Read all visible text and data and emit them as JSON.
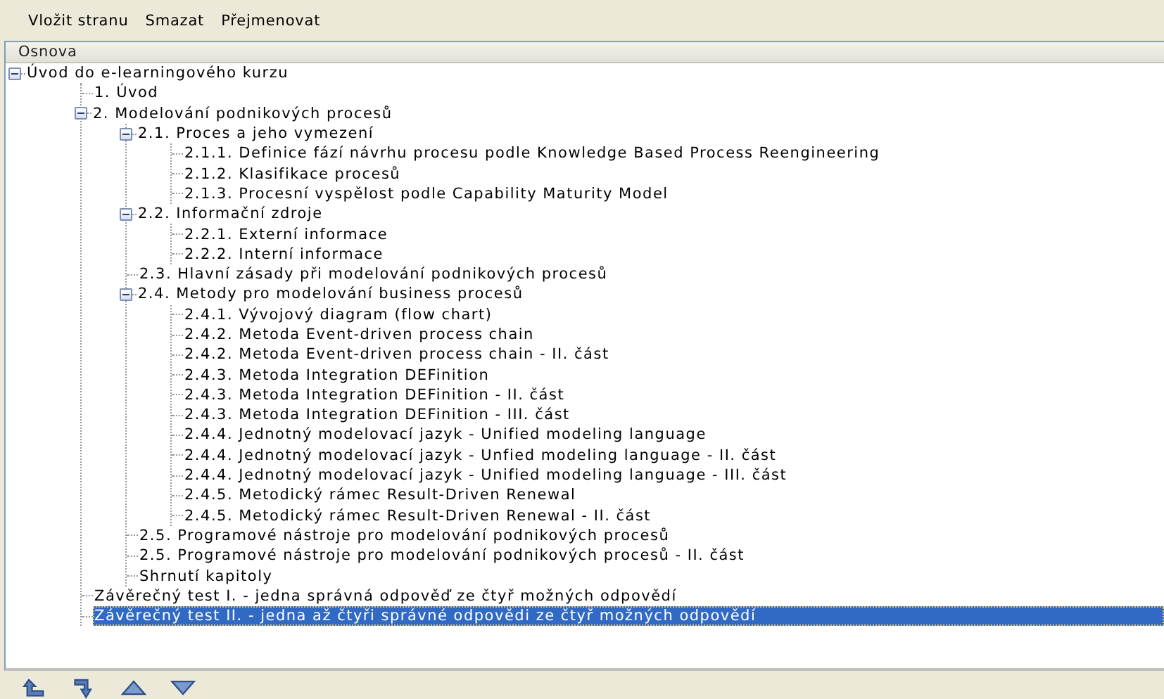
{
  "menu": [
    "Vložit stranu",
    "Smazat",
    "Přejmenovat"
  ],
  "outline": {
    "header": "Osnova",
    "items": [
      {
        "label": "Úvod do e-learningového kurzu",
        "expanded": true,
        "selected": false,
        "children": [
          {
            "label": "1. Úvod",
            "selected": false
          },
          {
            "label": "2. Modelování podnikových procesů",
            "expanded": true,
            "selected": false,
            "children": [
              {
                "label": "2.1. Proces a jeho vymezení",
                "expanded": true,
                "selected": false,
                "children": [
                  {
                    "label": "2.1.1. Definice fází návrhu procesu podle Knowledge Based Process Reengineering",
                    "selected": false
                  },
                  {
                    "label": "2.1.2. Klasifikace procesů",
                    "selected": false
                  },
                  {
                    "label": "2.1.3. Procesní vyspělost podle Capability Maturity Model",
                    "selected": false
                  }
                ]
              },
              {
                "label": "2.2. Informační zdroje",
                "expanded": true,
                "selected": false,
                "children": [
                  {
                    "label": "2.2.1. Externí informace",
                    "selected": false
                  },
                  {
                    "label": "2.2.2. Interní informace",
                    "selected": false
                  }
                ]
              },
              {
                "label": "2.3. Hlavní zásady při modelování podnikových procesů",
                "selected": false
              },
              {
                "label": "2.4. Metody pro modelování business procesů",
                "expanded": true,
                "selected": false,
                "children": [
                  {
                    "label": "2.4.1. Vývojový diagram (flow chart)",
                    "selected": false
                  },
                  {
                    "label": "2.4.2. Metoda Event-driven process chain",
                    "selected": false
                  },
                  {
                    "label": "2.4.2. Metoda Event-driven process chain - II. část",
                    "selected": false
                  },
                  {
                    "label": "2.4.3. Metoda Integration DEFinition",
                    "selected": false
                  },
                  {
                    "label": "2.4.3. Metoda Integration DEFinition - II. část",
                    "selected": false
                  },
                  {
                    "label": "2.4.3. Metoda Integration DEFinition - III. část",
                    "selected": false
                  },
                  {
                    "label": "2.4.4. Jednotný modelovací jazyk - Unified modeling language",
                    "selected": false
                  },
                  {
                    "label": "2.4.4. Jednotný modelovací jazyk - Unfied modeling language - II. část",
                    "selected": false
                  },
                  {
                    "label": "2.4.4. Jednotný modelovací jazyk - Unified modeling language - III. část",
                    "selected": false
                  },
                  {
                    "label": "2.4.5. Metodický rámec Result-Driven Renewal",
                    "selected": false
                  },
                  {
                    "label": "2.4.5. Metodický rámec Result-Driven Renewal - II. část",
                    "selected": false
                  }
                ]
              },
              {
                "label": "2.5. Programové nástroje pro modelování podnikových procesů",
                "selected": false
              },
              {
                "label": "2.5. Programové nástroje pro modelování podnikových procesů - II. část",
                "selected": false
              },
              {
                "label": "Shrnutí kapitoly",
                "selected": false
              }
            ]
          },
          {
            "label": "Závěrečný test I. - jedna správná odpověď ze čtyř možných odpovědí",
            "selected": false
          },
          {
            "label": "Závěrečný test II. - jedna až čtyři správné odpovědi ze čtyř možných odpovědí",
            "selected": true
          }
        ]
      }
    ]
  },
  "bottom_toolbar": [
    {
      "kind": "move-out"
    },
    {
      "kind": "move-in"
    },
    {
      "kind": "move-up"
    },
    {
      "kind": "move-down"
    }
  ]
}
